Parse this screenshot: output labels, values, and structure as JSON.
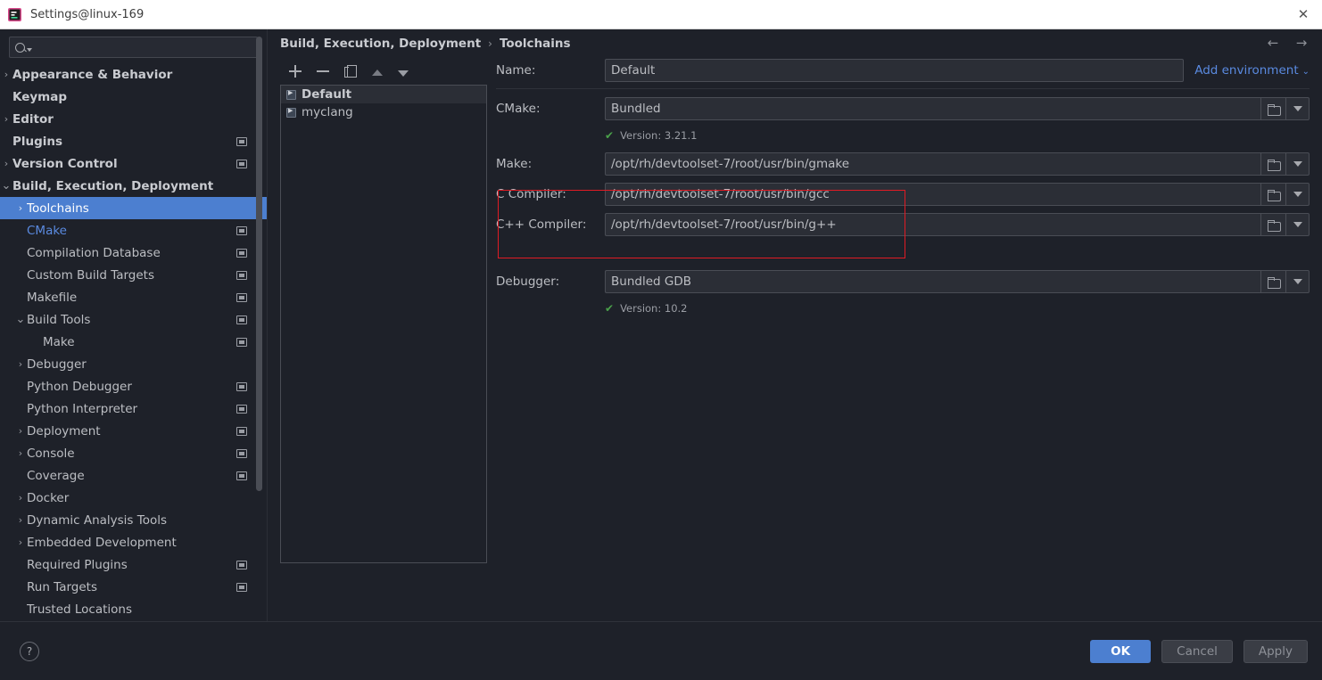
{
  "window": {
    "title": "Settings@linux-169",
    "app_icon": "settings-app-icon",
    "close_label": "✕"
  },
  "search": {
    "placeholder": "",
    "value": "",
    "icon": "search-icon"
  },
  "sidebar": {
    "items": [
      {
        "label": "Appearance & Behavior",
        "level": 0,
        "arrow": "›",
        "badge": false,
        "selected": false,
        "modified": false
      },
      {
        "label": "Keymap",
        "level": 0,
        "arrow": "",
        "badge": false,
        "selected": false,
        "modified": false
      },
      {
        "label": "Editor",
        "level": 0,
        "arrow": "›",
        "badge": false,
        "selected": false,
        "modified": false
      },
      {
        "label": "Plugins",
        "level": 0,
        "arrow": "",
        "badge": true,
        "selected": false,
        "modified": false
      },
      {
        "label": "Version Control",
        "level": 0,
        "arrow": "›",
        "badge": true,
        "selected": false,
        "modified": false
      },
      {
        "label": "Build, Execution, Deployment",
        "level": 0,
        "arrow": "⌄",
        "badge": false,
        "selected": false,
        "modified": false
      },
      {
        "label": "Toolchains",
        "level": 1,
        "arrow": "›",
        "badge": false,
        "selected": true,
        "modified": false
      },
      {
        "label": "CMake",
        "level": 1,
        "arrow": "",
        "badge": true,
        "selected": false,
        "modified": true
      },
      {
        "label": "Compilation Database",
        "level": 1,
        "arrow": "",
        "badge": true,
        "selected": false,
        "modified": false
      },
      {
        "label": "Custom Build Targets",
        "level": 1,
        "arrow": "",
        "badge": true,
        "selected": false,
        "modified": false
      },
      {
        "label": "Makefile",
        "level": 1,
        "arrow": "",
        "badge": true,
        "selected": false,
        "modified": false
      },
      {
        "label": "Build Tools",
        "level": 1,
        "arrow": "⌄",
        "badge": true,
        "selected": false,
        "modified": false
      },
      {
        "label": "Make",
        "level": 2,
        "arrow": "",
        "badge": true,
        "selected": false,
        "modified": false
      },
      {
        "label": "Debugger",
        "level": 1,
        "arrow": "›",
        "badge": false,
        "selected": false,
        "modified": false
      },
      {
        "label": "Python Debugger",
        "level": 1,
        "arrow": "",
        "badge": true,
        "selected": false,
        "modified": false
      },
      {
        "label": "Python Interpreter",
        "level": 1,
        "arrow": "",
        "badge": true,
        "selected": false,
        "modified": false
      },
      {
        "label": "Deployment",
        "level": 1,
        "arrow": "›",
        "badge": true,
        "selected": false,
        "modified": false
      },
      {
        "label": "Console",
        "level": 1,
        "arrow": "›",
        "badge": true,
        "selected": false,
        "modified": false
      },
      {
        "label": "Coverage",
        "level": 1,
        "arrow": "",
        "badge": true,
        "selected": false,
        "modified": false
      },
      {
        "label": "Docker",
        "level": 1,
        "arrow": "›",
        "badge": false,
        "selected": false,
        "modified": false
      },
      {
        "label": "Dynamic Analysis Tools",
        "level": 1,
        "arrow": "›",
        "badge": false,
        "selected": false,
        "modified": false
      },
      {
        "label": "Embedded Development",
        "level": 1,
        "arrow": "›",
        "badge": false,
        "selected": false,
        "modified": false
      },
      {
        "label": "Required Plugins",
        "level": 1,
        "arrow": "",
        "badge": true,
        "selected": false,
        "modified": false
      },
      {
        "label": "Run Targets",
        "level": 1,
        "arrow": "",
        "badge": true,
        "selected": false,
        "modified": false
      },
      {
        "label": "Trusted Locations",
        "level": 1,
        "arrow": "",
        "badge": false,
        "selected": false,
        "modified": false
      }
    ]
  },
  "breadcrumb": {
    "parent": "Build, Execution, Deployment",
    "separator": "›",
    "current": "Toolchains",
    "back_icon": "←",
    "forward_icon": "→"
  },
  "toolchain_list": {
    "toolbar": [
      {
        "name": "add-toolchain-button",
        "icon": "plus-icon"
      },
      {
        "name": "remove-toolchain-button",
        "icon": "minus-icon"
      },
      {
        "name": "copy-toolchain-button",
        "icon": "copy-icon"
      },
      {
        "name": "move-up-button",
        "icon": "arrow-up-icon"
      },
      {
        "name": "move-down-button",
        "icon": "arrow-down-icon"
      }
    ],
    "items": [
      {
        "label": "Default",
        "selected": true
      },
      {
        "label": "myclang",
        "selected": false
      }
    ]
  },
  "form": {
    "name": {
      "label": "Name:",
      "value": "Default"
    },
    "add_environment": {
      "label": "Add environment",
      "caret": "⌄"
    },
    "cmake": {
      "label": "CMake:",
      "value": "Bundled",
      "version": "Version: 3.21.1",
      "check": "✔"
    },
    "make": {
      "label": "Make:",
      "value": "/opt/rh/devtoolset-7/root/usr/bin/gmake"
    },
    "c_compiler": {
      "label": "C Compiler:",
      "value": "/opt/rh/devtoolset-7/root/usr/bin/gcc"
    },
    "cpp_compiler": {
      "label": "C++ Compiler:",
      "value": "/opt/rh/devtoolset-7/root/usr/bin/g++"
    },
    "debugger": {
      "label": "Debugger:",
      "value": "Bundled GDB",
      "version": "Version: 10.2",
      "check": "✔"
    },
    "highlight_color": "#e01b24"
  },
  "footer": {
    "help_label": "?",
    "ok_label": "OK",
    "cancel_label": "Cancel",
    "apply_label": "Apply",
    "primary_color": "#4c7fd0"
  }
}
